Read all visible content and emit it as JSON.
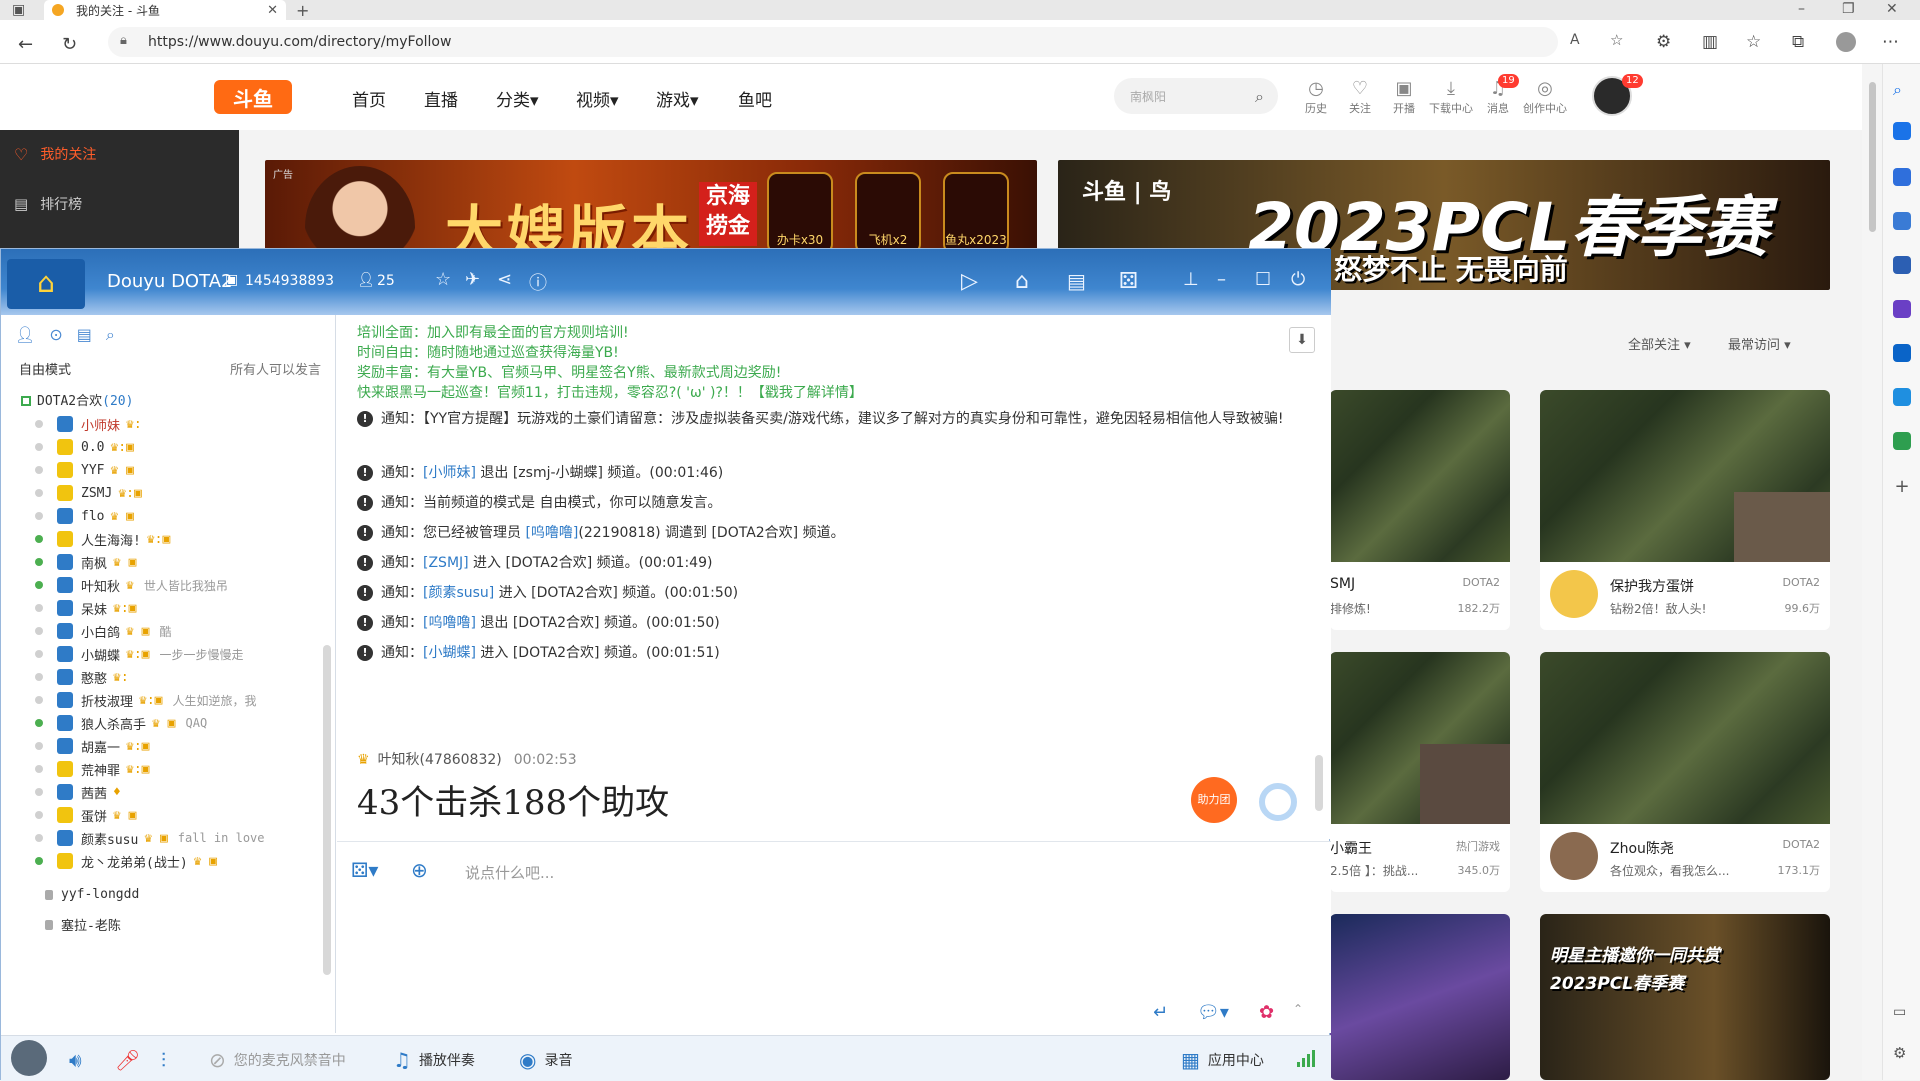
{
  "browser": {
    "tab_title": "我的关注 - 斗鱼",
    "url": "https://www.douyu.com/directory/myFollow"
  },
  "site": {
    "logo": "斗鱼",
    "nav": [
      "首页",
      "直播",
      "分类▾",
      "视频▾",
      "游戏▾",
      "鱼吧"
    ],
    "search_placeholder": "南枫阳",
    "header_icons": [
      {
        "label": "历史",
        "icon": "clock-icon"
      },
      {
        "label": "关注",
        "icon": "heart-icon"
      },
      {
        "label": "开播",
        "icon": "camera-icon"
      },
      {
        "label": "下载中心",
        "icon": "download-icon"
      },
      {
        "label": "消息",
        "icon": "bell-icon",
        "badge": "19"
      },
      {
        "label": "创作中心",
        "icon": "bulb-icon"
      }
    ],
    "avatar_badge": "12",
    "left_menu": [
      {
        "label": "我的关注",
        "active": true
      },
      {
        "label": "排行榜",
        "active": false
      }
    ],
    "banner1": {
      "tag": "广告",
      "title": "大嫂版本",
      "jd": "京海捞金",
      "gifts": [
        "办卡x30",
        "飞机x2",
        "鱼丸x2023"
      ]
    },
    "banner2": {
      "logo": "斗鱼 | 鸟",
      "title": "2023PCL春季赛",
      "sub": "怒梦不止 无畏向前"
    },
    "filters": [
      "全部关注 ▾",
      "最常访问 ▾"
    ],
    "cards": [
      {
        "name": "SMJ",
        "cat": "DOTA2",
        "desc": "排修炼!",
        "hot": "182.2万"
      },
      {
        "name": "保护我方蛋饼",
        "cat": "DOTA2",
        "desc": "钻粉2倍！敌人头!",
        "hot": "99.6万"
      },
      {
        "name": "小霸王",
        "cat": "热门游戏",
        "desc": "2.5倍 】：挑战...",
        "hot": "345.0万"
      },
      {
        "name": "Zhou陈尧",
        "cat": "DOTA2",
        "desc": "各位观众，看我怎么...",
        "hot": "173.1万"
      },
      {
        "name": "",
        "cat": "",
        "desc": "",
        "hot": ""
      },
      {
        "name": "明星主播邀你一同共赏 2023PCL春季赛",
        "cat": "",
        "desc": "",
        "hot": ""
      }
    ]
  },
  "yy": {
    "title": "Douyu DOTA2",
    "room_id": "1454938893",
    "online": "25",
    "mode": "自由模式",
    "mode_perm": "所有人可以发言",
    "channel": "DOTA2合欢",
    "channel_count": "(20)",
    "members": [
      {
        "name": "小师妹",
        "online": false,
        "color": "#c0392b",
        "shirt": "#2f7bc7",
        "crown": "♛:",
        "sig": ""
      },
      {
        "name": "0.0",
        "online": false,
        "color": "#333",
        "shirt": "#f1c40f",
        "crown": "♛:▣",
        "sig": ""
      },
      {
        "name": "YYF",
        "online": false,
        "color": "#333",
        "shirt": "#f1c40f",
        "crown": "♛ ▣",
        "sig": ""
      },
      {
        "name": "ZSMJ",
        "online": false,
        "color": "#333",
        "shirt": "#f1c40f",
        "crown": "♛:▣",
        "sig": ""
      },
      {
        "name": "flo",
        "online": false,
        "color": "#333",
        "shirt": "#2f7bc7",
        "crown": "♛ ▣",
        "sig": ""
      },
      {
        "name": "人生海海!",
        "online": true,
        "color": "#333",
        "shirt": "#f1c40f",
        "crown": "♛:▣",
        "sig": ""
      },
      {
        "name": "南枫",
        "online": true,
        "color": "#333",
        "shirt": "#2f7bc7",
        "crown": "♛ ▣",
        "sig": ""
      },
      {
        "name": "叶知秋",
        "online": true,
        "color": "#333",
        "shirt": "#2f7bc7",
        "crown": "♛",
        "sig": "世人皆比我独吊"
      },
      {
        "name": "呆妹",
        "online": false,
        "color": "#333",
        "shirt": "#2f7bc7",
        "crown": "♛:▣",
        "sig": ""
      },
      {
        "name": "小白鸽",
        "online": false,
        "color": "#333",
        "shirt": "#2f7bc7",
        "crown": "♛  ▣",
        "sig": "酷"
      },
      {
        "name": "小蝴蝶",
        "online": false,
        "color": "#333",
        "shirt": "#2f7bc7",
        "crown": "♛:▣",
        "sig": "一步一步慢慢走"
      },
      {
        "name": "憨憨",
        "online": false,
        "color": "#333",
        "shirt": "#2f7bc7",
        "crown": "♛:",
        "sig": ""
      },
      {
        "name": "折枝淑理",
        "online": false,
        "color": "#333",
        "shirt": "#2f7bc7",
        "crown": "♛:▣",
        "sig": "人生如逆旅，我"
      },
      {
        "name": "狼人杀高手",
        "online": true,
        "color": "#333",
        "shirt": "#2f7bc7",
        "crown": "♛ ▣",
        "sig": "QAQ"
      },
      {
        "name": "胡嘉一",
        "online": false,
        "color": "#333",
        "shirt": "#2f7bc7",
        "crown": "♛:▣",
        "sig": ""
      },
      {
        "name": "荒神罪",
        "online": false,
        "color": "#333",
        "shirt": "#f1c40f",
        "crown": "♛:▣",
        "sig": ""
      },
      {
        "name": "茜茜",
        "online": false,
        "color": "#333",
        "shirt": "#2f7bc7",
        "crown": "♦",
        "sig": ""
      },
      {
        "name": "蛋饼",
        "online": false,
        "color": "#333",
        "shirt": "#f1c40f",
        "crown": "♛ ▣",
        "sig": ""
      },
      {
        "name": "颜素susu",
        "online": false,
        "color": "#333",
        "shirt": "#2f7bc7",
        "crown": "♛ ▣",
        "sig": "fall in love"
      },
      {
        "name": "龙丶龙弟弟(战士)",
        "online": true,
        "color": "#333",
        "shirt": "#f1c40f",
        "crown": "♛ ▣",
        "sig": ""
      }
    ],
    "sub_channels": [
      "yyf-longdd",
      "塞拉-老陈"
    ],
    "announcement": [
      "培训全面：加入即有最全面的官方规则培训!",
      "时间自由：随时随地通过巡查获得海量YB!",
      "奖励丰富：有大量YB、官频马甲、明星签名Y熊、最新款式周边奖励!",
      "快来跟黑马一起巡查！官频11，打击违规，零容忍?( 'ω' )?！！【戳我了解详情】"
    ],
    "notices": [
      {
        "pre": "通知：【YY官方提醒】玩游戏的土豪们请留意：涉及虚拟装备买卖/游戏代练，建议多了解对方的真实身份和可靠性，避免因轻易相信他人导致被骗!",
        "link": "",
        "post": ""
      },
      {
        "pre": "通知：",
        "link": "[小师妹]",
        "post": " 退出 [zsmj-小蝴蝶] 频道。(00:01:46)"
      },
      {
        "pre": "通知：当前频道的模式是 自由模式，你可以随意发言。",
        "link": "",
        "post": ""
      },
      {
        "pre": "通知：您已经被管理员 ",
        "link": "[呜噜噜]",
        "post": "(22190818) 调遣到 [DOTA2合欢] 频道。"
      },
      {
        "pre": "通知：",
        "link": "[ZSMJ]",
        "post": " 进入 [DOTA2合欢] 频道。(00:01:49)"
      },
      {
        "pre": "通知：",
        "link": "[颜素susu]",
        "post": " 进入 [DOTA2合欢] 频道。(00:01:50)"
      },
      {
        "pre": "通知：",
        "link": "[呜噜噜]",
        "post": " 退出 [DOTA2合欢] 频道。(00:01:50)"
      },
      {
        "pre": "通知：",
        "link": "[小蝴蝶]",
        "post": " 进入 [DOTA2合欢] 频道。(00:01:51)"
      }
    ],
    "speaker": "叶知秋(47860832)",
    "speaker_time": "00:02:53",
    "message": "43个击杀188个助攻",
    "assist_label": "助力团",
    "input_placeholder": "说点什么吧...",
    "bottom": {
      "mic_status": "您的麦克风禁音中",
      "play": "播放伴奏",
      "record": "录音",
      "apps": "应用中心"
    }
  },
  "colors": {
    "douyu_orange": "#ff6a13",
    "yy_blue": "#2f7bc7",
    "notice_green": "#3caa4e"
  }
}
